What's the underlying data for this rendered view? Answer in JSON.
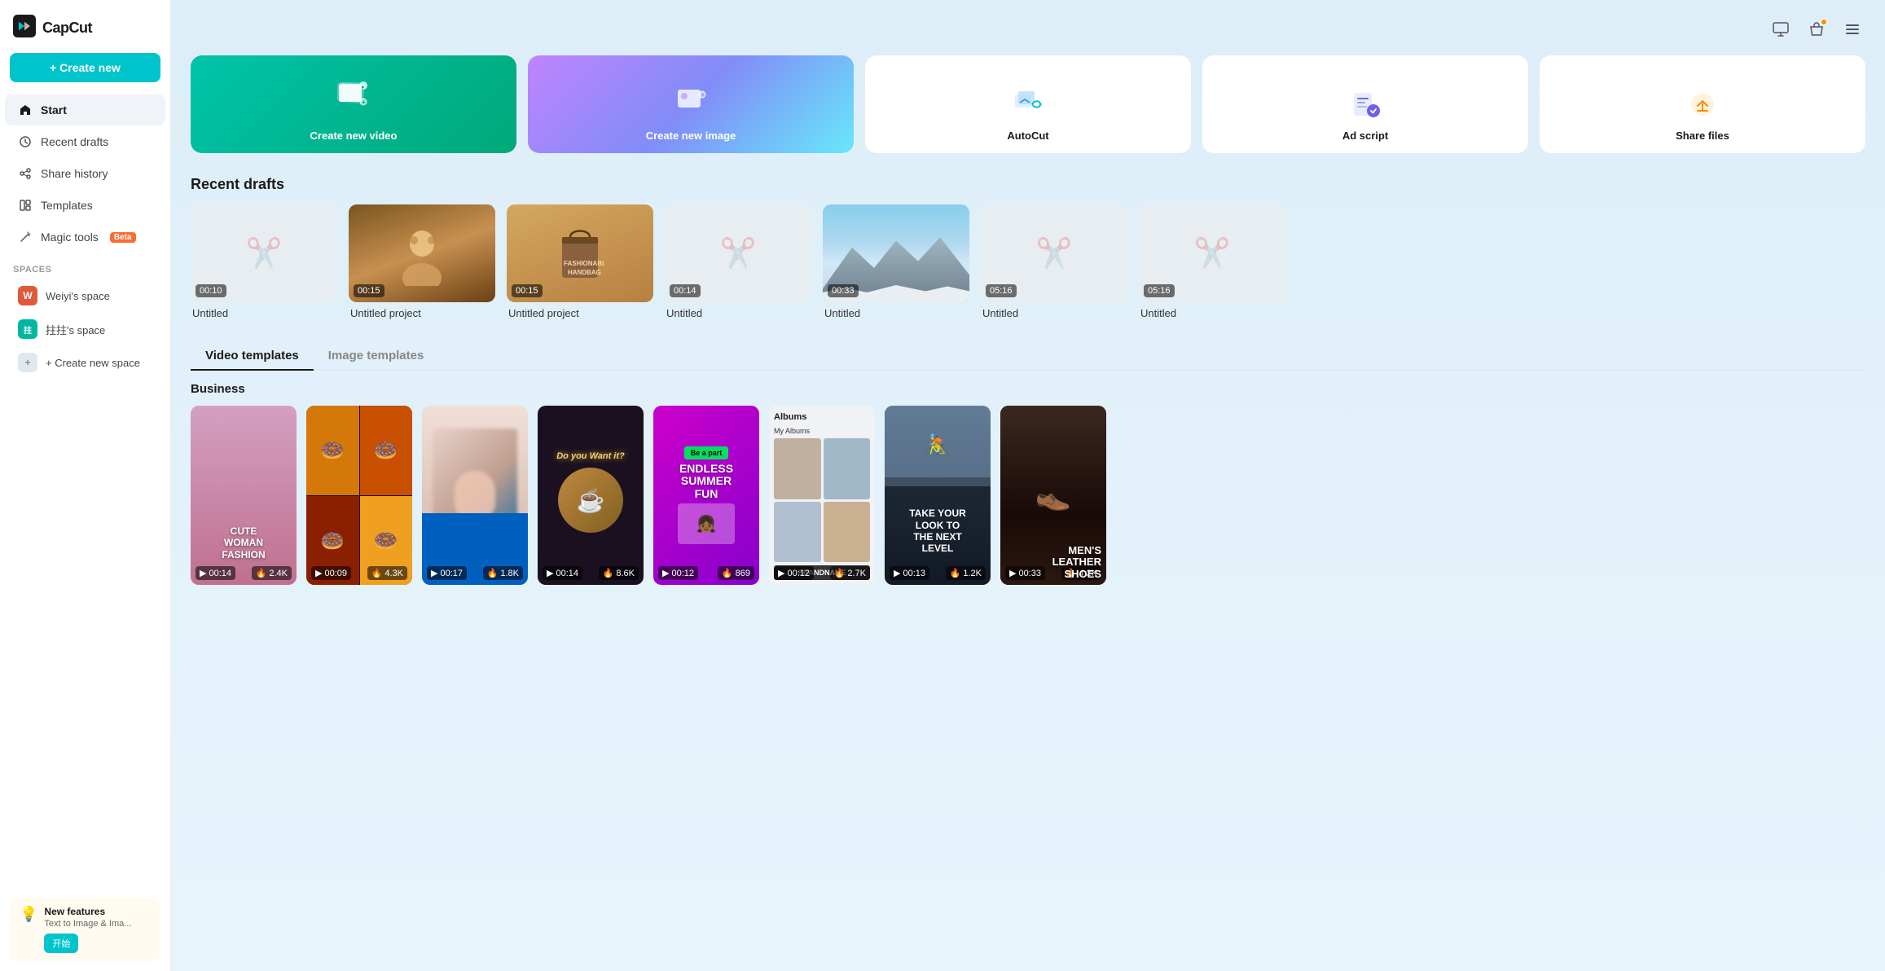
{
  "app": {
    "name": "CapCut",
    "logo_text": "CapCut"
  },
  "sidebar": {
    "create_new_label": "+ Create new",
    "nav_items": [
      {
        "id": "start",
        "label": "Start",
        "icon": "home",
        "active": true
      },
      {
        "id": "recent-drafts",
        "label": "Recent drafts",
        "icon": "clock",
        "active": false
      },
      {
        "id": "share-history",
        "label": "Share history",
        "icon": "share",
        "active": false
      },
      {
        "id": "templates",
        "label": "Templates",
        "icon": "layout",
        "active": false
      },
      {
        "id": "magic-tools",
        "label": "Magic tools",
        "icon": "wand",
        "active": false,
        "badge": "Beta"
      }
    ],
    "spaces_label": "Spaces",
    "spaces": [
      {
        "id": "weiyi",
        "label": "Weiyi's space",
        "color": "#e05a3a",
        "letter": "W"
      },
      {
        "id": "zhuzhui",
        "label": "拄拄's space",
        "color": "#00b8a0",
        "letter": "拄"
      }
    ],
    "create_space_label": "+ Create new space",
    "new_features": {
      "title": "New features",
      "text": "Text to Image & Ima...",
      "start_label": "开始"
    }
  },
  "topbar": {
    "icons": [
      "desktop",
      "bag",
      "menu"
    ]
  },
  "quick_actions": [
    {
      "id": "create-video",
      "label": "Create new video",
      "type": "video",
      "icon": "🎬"
    },
    {
      "id": "create-image",
      "label": "Create new image",
      "type": "image",
      "icon": "🖼️"
    },
    {
      "id": "autocut",
      "label": "AutoCut",
      "type": "autocut",
      "icon": "✂️"
    },
    {
      "id": "ad-script",
      "label": "Ad script",
      "type": "adscript",
      "icon": "📝"
    },
    {
      "id": "share-files",
      "label": "Share files",
      "type": "sharefiles",
      "icon": "📤"
    }
  ],
  "recent_drafts": {
    "title": "Recent drafts",
    "items": [
      {
        "id": 1,
        "name": "Untitled",
        "time": "00:10",
        "has_thumb": false
      },
      {
        "id": 2,
        "name": "Untitled project",
        "time": "00:15",
        "has_thumb": true,
        "thumb_type": "people"
      },
      {
        "id": 3,
        "name": "Untitled project",
        "time": "00:15",
        "has_thumb": true,
        "thumb_type": "bag"
      },
      {
        "id": 4,
        "name": "Untitled",
        "time": "00:14",
        "has_thumb": false
      },
      {
        "id": 5,
        "name": "Untitled",
        "time": "00:33",
        "has_thumb": true,
        "thumb_type": "mountain"
      },
      {
        "id": 6,
        "name": "Untitled",
        "time": "05:16",
        "has_thumb": false
      },
      {
        "id": 7,
        "name": "Untitled",
        "time": "05:16",
        "has_thumb": false
      }
    ]
  },
  "templates": {
    "tabs": [
      {
        "id": "video",
        "label": "Video templates",
        "active": true
      },
      {
        "id": "image",
        "label": "Image templates",
        "active": false
      }
    ],
    "business_title": "Business",
    "items": [
      {
        "id": 1,
        "time": "00:14",
        "likes": "2.4K",
        "color": "t1",
        "text": "CUTE WOMAN FASHION"
      },
      {
        "id": 2,
        "time": "00:09",
        "likes": "4.3K",
        "color": "t2",
        "text": ""
      },
      {
        "id": 3,
        "time": "00:17",
        "likes": "1.8K",
        "color": "t3",
        "text": ""
      },
      {
        "id": 4,
        "time": "00:14",
        "likes": "8.6K",
        "color": "t4",
        "text": "Do you Want it?"
      },
      {
        "id": 5,
        "time": "00:12",
        "likes": "869",
        "color": "t5",
        "text": "ENDLESS SUMMER FUN"
      },
      {
        "id": 6,
        "time": "00:12",
        "likes": "2.7K",
        "color": "t6",
        "text": "Albums"
      },
      {
        "id": 7,
        "time": "00:13",
        "likes": "1.2K",
        "color": "t7",
        "text": "TAKE YOUR LOOK TO THE NEXT LEVEL"
      },
      {
        "id": 8,
        "time": "00:33",
        "likes": "4.2K",
        "color": "t8",
        "text": "MEN'S LEATHER SHOES"
      }
    ]
  }
}
